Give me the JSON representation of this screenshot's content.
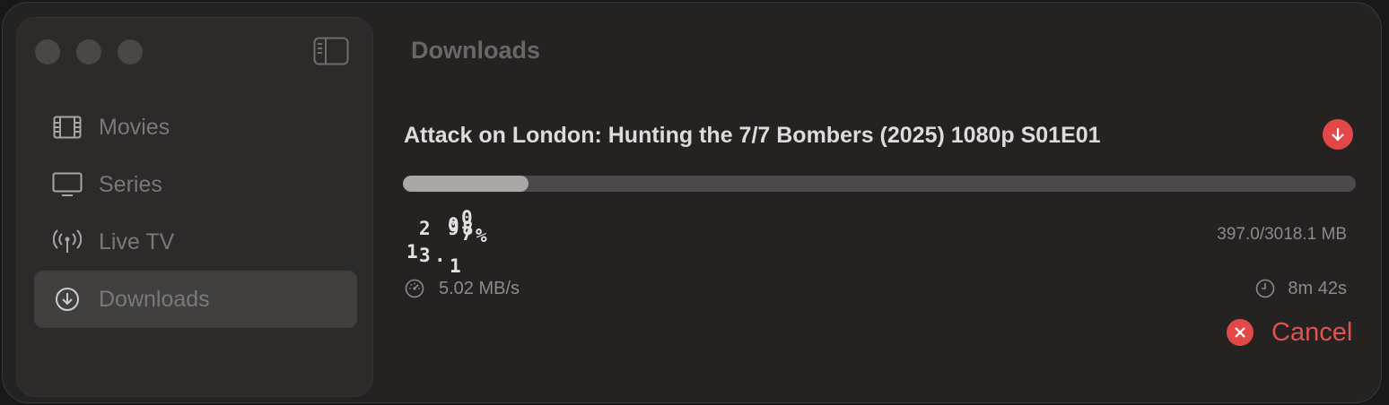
{
  "window": {
    "title": "Downloads"
  },
  "sidebar": {
    "items": [
      {
        "label": "Movies",
        "icon": "film-icon",
        "active": false
      },
      {
        "label": "Series",
        "icon": "tv-icon",
        "active": false
      },
      {
        "label": "Live TV",
        "icon": "broadcast-icon",
        "active": false
      },
      {
        "label": "Downloads",
        "icon": "download-circle-icon",
        "active": true
      }
    ]
  },
  "download": {
    "title": "Attack on London: Hunting the 7/7 Bombers (2025) 1080p S01E01",
    "progress_fraction": 0.1315,
    "percent_glyphs": [
      "2",
      "0",
      "0",
      "9",
      "8",
      "%",
      "1",
      "3",
      ".",
      "1",
      "7"
    ],
    "size": "397.0/3018.1 MB",
    "speed": "5.02 MB/s",
    "eta": "8m 42s",
    "cancel_label": "Cancel"
  },
  "colors": {
    "accent_red": "#e34848",
    "progress_fill": "#aaa8a6",
    "progress_track": "#4b4949"
  }
}
